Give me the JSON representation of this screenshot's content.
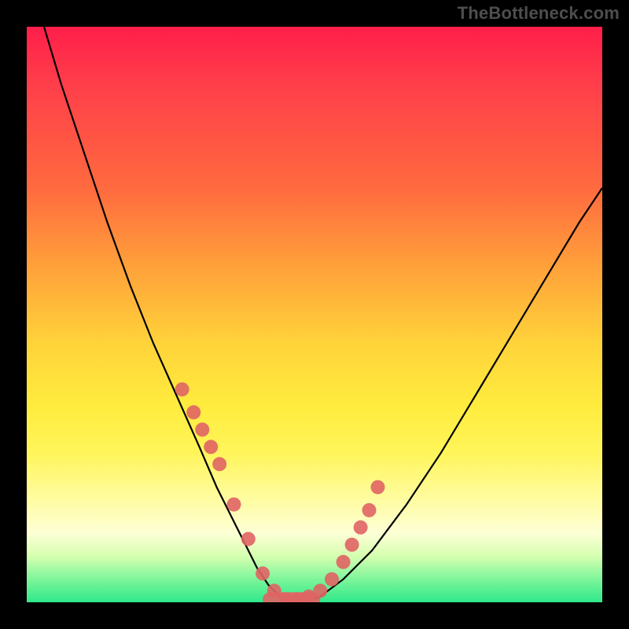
{
  "watermark": "TheBottleneck.com",
  "colors": {
    "background": "#000000",
    "gradient_top": "#ff1e4a",
    "gradient_mid": "#ffec3e",
    "gradient_bottom": "#2ee98b",
    "curve": "#000000",
    "dots": "#e06464"
  },
  "chart_data": {
    "type": "line",
    "title": "",
    "xlabel": "",
    "ylabel": "",
    "xlim": [
      0,
      100
    ],
    "ylim": [
      0,
      100
    ],
    "grid": false,
    "legend": false,
    "series": [
      {
        "name": "curve",
        "x": [
          3,
          6,
          10,
          14,
          18,
          22,
          26,
          30,
          33,
          36,
          38,
          40,
          42,
          44,
          46,
          48,
          51,
          55,
          60,
          66,
          72,
          78,
          84,
          90,
          96,
          100
        ],
        "y": [
          100,
          90,
          78,
          66,
          55,
          45,
          36,
          27,
          20,
          14,
          10,
          6,
          3,
          1,
          0,
          0,
          1,
          4,
          9,
          17,
          26,
          36,
          46,
          56,
          66,
          72
        ],
        "note": "Percent of plot area; y=0 is bottom (green), y=100 is top (red). Approx V-shaped curve with minimum near x≈45-50."
      }
    ],
    "dots": {
      "name": "highlighted-points",
      "x": [
        27,
        29,
        30.5,
        32,
        33.5,
        36,
        38.5,
        41,
        43,
        45,
        47,
        49,
        51,
        53,
        55,
        56.5,
        58,
        59.5,
        61
      ],
      "y": [
        37,
        33,
        30,
        27,
        24,
        17,
        11,
        5,
        2,
        0.5,
        0.5,
        1,
        2,
        4,
        7,
        10,
        13,
        16,
        20
      ],
      "note": "Salmon circular markers lying on the curve near the trough region."
    },
    "pill": {
      "x_start": 41,
      "x_end": 51,
      "y": 0.5,
      "note": "Flat salmon rounded bar along the very bottom between the two dot clusters."
    }
  }
}
